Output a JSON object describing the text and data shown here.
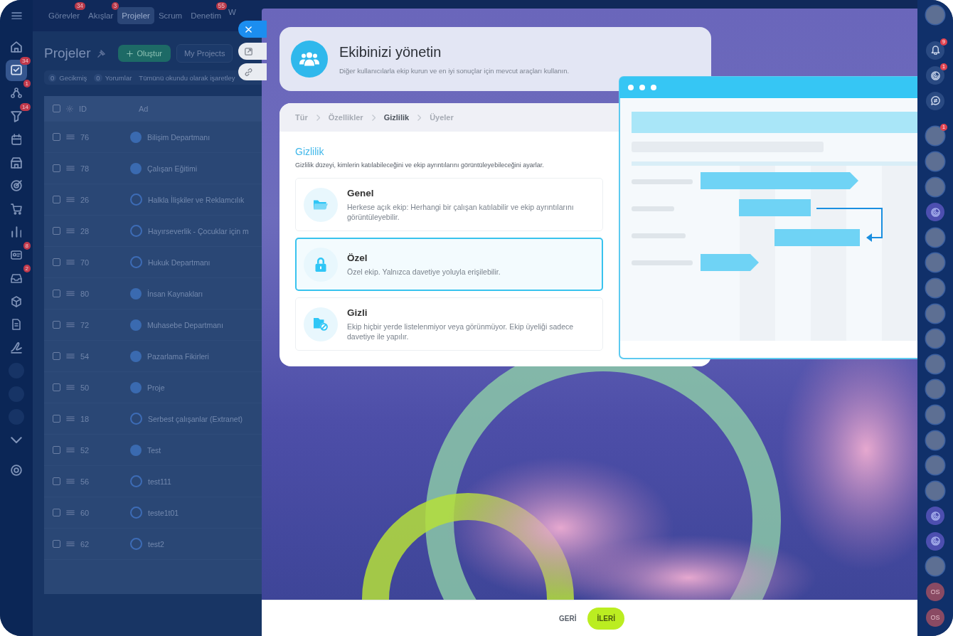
{
  "left_nav": {
    "items": [
      {
        "kind": "home",
        "selected": false
      },
      {
        "kind": "tasks",
        "selected": true,
        "badge": "34"
      },
      {
        "kind": "flows",
        "selected": false,
        "badge": "1"
      },
      {
        "kind": "funnel",
        "selected": false,
        "badge": "14"
      },
      {
        "kind": "calendar",
        "selected": false
      },
      {
        "kind": "store",
        "selected": false
      },
      {
        "kind": "target",
        "selected": false
      },
      {
        "kind": "cart",
        "selected": false
      },
      {
        "kind": "chart",
        "selected": false
      },
      {
        "kind": "contacts",
        "selected": false,
        "badge": "8"
      },
      {
        "kind": "inbox",
        "selected": false,
        "badge": "2"
      },
      {
        "kind": "box",
        "selected": false
      },
      {
        "kind": "doc",
        "selected": false
      },
      {
        "kind": "sign",
        "selected": false
      },
      {
        "kind": "dot",
        "selected": false
      },
      {
        "kind": "dot",
        "selected": false
      },
      {
        "kind": "dot",
        "selected": false
      },
      {
        "kind": "chevron",
        "selected": false
      },
      {
        "kind": "settings",
        "selected": false
      }
    ]
  },
  "top_tabs": [
    {
      "label": "Görevler",
      "badge": "34",
      "selected": false
    },
    {
      "label": "Akışlar",
      "badge": "3",
      "selected": false
    },
    {
      "label": "Projeler",
      "selected": true
    },
    {
      "label": "Scrum",
      "selected": false
    },
    {
      "label": "Denetim",
      "badge": "55",
      "selected": false
    },
    {
      "label": "W",
      "selected": false
    }
  ],
  "page": {
    "title": "Projeler",
    "create_button": "Oluştur",
    "filter_chip": "My Projects",
    "counters": [
      {
        "count": "0",
        "label": "Gecikmiş"
      },
      {
        "count": "0",
        "label": "Yorumlar"
      }
    ],
    "mark_all": "Tümünü okundu olarak işaretley"
  },
  "table": {
    "columns": [
      "ID",
      "Ad"
    ],
    "all_selected": false,
    "rows": [
      {
        "id": "76",
        "name": "Bilişim Departmanı",
        "kind": "photo",
        "selected": false
      },
      {
        "id": "78",
        "name": "Çalışan Eğitimi",
        "kind": "photo",
        "selected": false
      },
      {
        "id": "26",
        "name": "Halkla İlişkiler ve Reklamcılık",
        "kind": "folder",
        "selected": false
      },
      {
        "id": "28",
        "name": "Hayırseverlik - Çocuklar için m",
        "kind": "folder",
        "selected": false
      },
      {
        "id": "70",
        "name": "Hukuk Departmanı",
        "kind": "folder",
        "selected": false
      },
      {
        "id": "80",
        "name": "İnsan Kaynakları",
        "kind": "photo",
        "selected": false
      },
      {
        "id": "72",
        "name": "Muhasebe Departmanı",
        "kind": "photo",
        "selected": false
      },
      {
        "id": "54",
        "name": "Pazarlama Fikirleri",
        "kind": "photo",
        "selected": false
      },
      {
        "id": "50",
        "name": "Proje",
        "kind": "photo",
        "selected": false
      },
      {
        "id": "18",
        "name": "Serbest çalışanlar (Extranet)",
        "kind": "folder",
        "selected": false
      },
      {
        "id": "52",
        "name": "Test",
        "kind": "photo",
        "selected": false
      },
      {
        "id": "56",
        "name": "test111",
        "kind": "folder",
        "selected": false
      },
      {
        "id": "60",
        "name": "teste1t01",
        "kind": "folder",
        "selected": false
      },
      {
        "id": "62",
        "name": "test2",
        "kind": "folder",
        "selected": false
      }
    ]
  },
  "panel": {
    "title": "Ekibinizi yönetin",
    "subtitle": "Diğer kullanıcılarla ekip kurun ve en iyi sonuçlar için mevcut araçları kullanın.",
    "steps": [
      {
        "label": "Tür",
        "current": false
      },
      {
        "label": "Özellikler",
        "current": false
      },
      {
        "label": "Gizlilik",
        "current": true
      },
      {
        "label": "Üyeler",
        "current": false
      }
    ],
    "section_title": "Gizlilik",
    "section_description": "Gizlilik düzeyi, kimlerin katılabileceğini ve ekip ayrıntılarını görüntüleyebileceğini ayarlar.",
    "options": [
      {
        "kind": "public",
        "title": "Genel",
        "description": "Herkese açık ekip: Herhangi bir çalışan katılabilir ve ekip ayrıntılarını görüntüleyebilir.",
        "selected": false
      },
      {
        "kind": "private",
        "title": "Özel",
        "description": "Özel ekip. Yalnızca davetiye yoluyla erişilebilir.",
        "selected": true
      },
      {
        "kind": "secret",
        "title": "Gizli",
        "description": "Ekip hiçbir yerde listelenmiyor veya görünmüyor. Ekip üyeliği sadece davetiye ile yapılır.",
        "selected": false
      }
    ],
    "back_button": "GERİ",
    "next_button": "İLERİ"
  },
  "right_bar": {
    "items": [
      {
        "kind": "avatar"
      },
      {
        "kind": "bell",
        "badge": "9"
      },
      {
        "kind": "pulse",
        "badge": "1"
      },
      {
        "kind": "chat"
      },
      {
        "kind": "avatar",
        "badge": "1"
      },
      {
        "kind": "avatar"
      },
      {
        "kind": "avatar"
      },
      {
        "kind": "group"
      },
      {
        "kind": "avatar"
      },
      {
        "kind": "avatar"
      },
      {
        "kind": "avatar"
      },
      {
        "kind": "avatar"
      },
      {
        "kind": "avatar"
      },
      {
        "kind": "avatar"
      },
      {
        "kind": "avatar"
      },
      {
        "kind": "avatar"
      },
      {
        "kind": "avatar"
      },
      {
        "kind": "avatar"
      },
      {
        "kind": "avatar"
      },
      {
        "kind": "group"
      },
      {
        "kind": "group"
      },
      {
        "kind": "avatar"
      },
      {
        "kind": "initials",
        "text": "OS"
      },
      {
        "kind": "initials",
        "text": "OS"
      }
    ]
  }
}
